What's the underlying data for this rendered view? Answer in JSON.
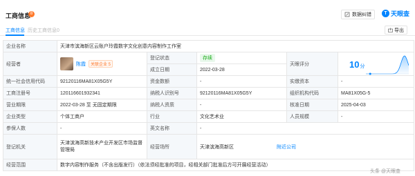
{
  "header": {
    "title": "工商信息",
    "badge": "8",
    "correct_label": "数据纠错",
    "brand": "天眼查",
    "brand_logo_text": "T"
  },
  "tabs": {
    "active": "工商信息",
    "history": "历史工商信息0",
    "export_label": "导出"
  },
  "company": {
    "name_label": "企业名称",
    "name": "天津市滨海新区云账户玲霞数字文化创意内容制作工作室",
    "rep_label": "经营者",
    "rep_name": "陈霞",
    "rep_badge": "关联企业 5",
    "status_label": "登记状态",
    "status": "存续",
    "founded_label": "成立日期",
    "founded": "2022-03-28",
    "score_label": "天眼评分",
    "score": "10",
    "score_unit": "分",
    "credit_code_label": "统一社会信用代码",
    "credit_code": "92120116MA81X05G5Y",
    "capital_label": "资金数额",
    "capital": "-",
    "paidin_label": "实缴资本",
    "paidin": "-",
    "reg_no_label": "工商注册号",
    "reg_no": "120116601932341",
    "taxpayer_id_label": "纳税人识别号",
    "taxpayer_id": "92120116MA81X05G5Y",
    "org_code_label": "组织机构代码",
    "org_code": "MA81X05G-5",
    "term_label": "营业期限",
    "term": "2022-03-28 至 无固定期限",
    "taxpayer_qual_label": "纳税人资质",
    "taxpayer_qual": "-",
    "approve_label": "核准日期",
    "approve": "2025-04-03",
    "type_label": "企业类型",
    "type": "个体工商户",
    "industry_label": "行业",
    "industry": "文化艺术业",
    "staff_label": "人员规模",
    "staff": "-",
    "insured_label": "参保人数",
    "insured": "-",
    "en_name_label": "英文名称",
    "en_name": "-",
    "authority_label": "登记机关",
    "authority": "天津滨海高新技术产业开发区市场监督管理局",
    "address_label": "经营场所",
    "address": "天津滨海高新区",
    "address_link": "附近公司",
    "scope_label": "经营范围",
    "scope": "数字内容制作服务（不含出版发行）（依法须经批准的项目，经相关部门批准后方可开展经营活动）"
  },
  "score_chart": {
    "peak_fraction": 0.9,
    "marker_score": 10
  },
  "watermark": "头条 @天眼查",
  "colors": {
    "accent": "#0084ff",
    "status_green": "#1aad19",
    "badge_orange": "#ff7a2c"
  }
}
